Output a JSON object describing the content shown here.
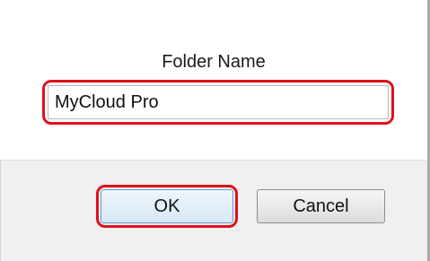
{
  "dialog": {
    "field_label": "Folder Name",
    "folder_name_value": "MyCloud Pro",
    "ok_label": "OK",
    "cancel_label": "Cancel"
  },
  "colors": {
    "highlight": "#e0101a",
    "footer_background": "#f0f0f0",
    "default_button_border": "#5a9fd4"
  }
}
